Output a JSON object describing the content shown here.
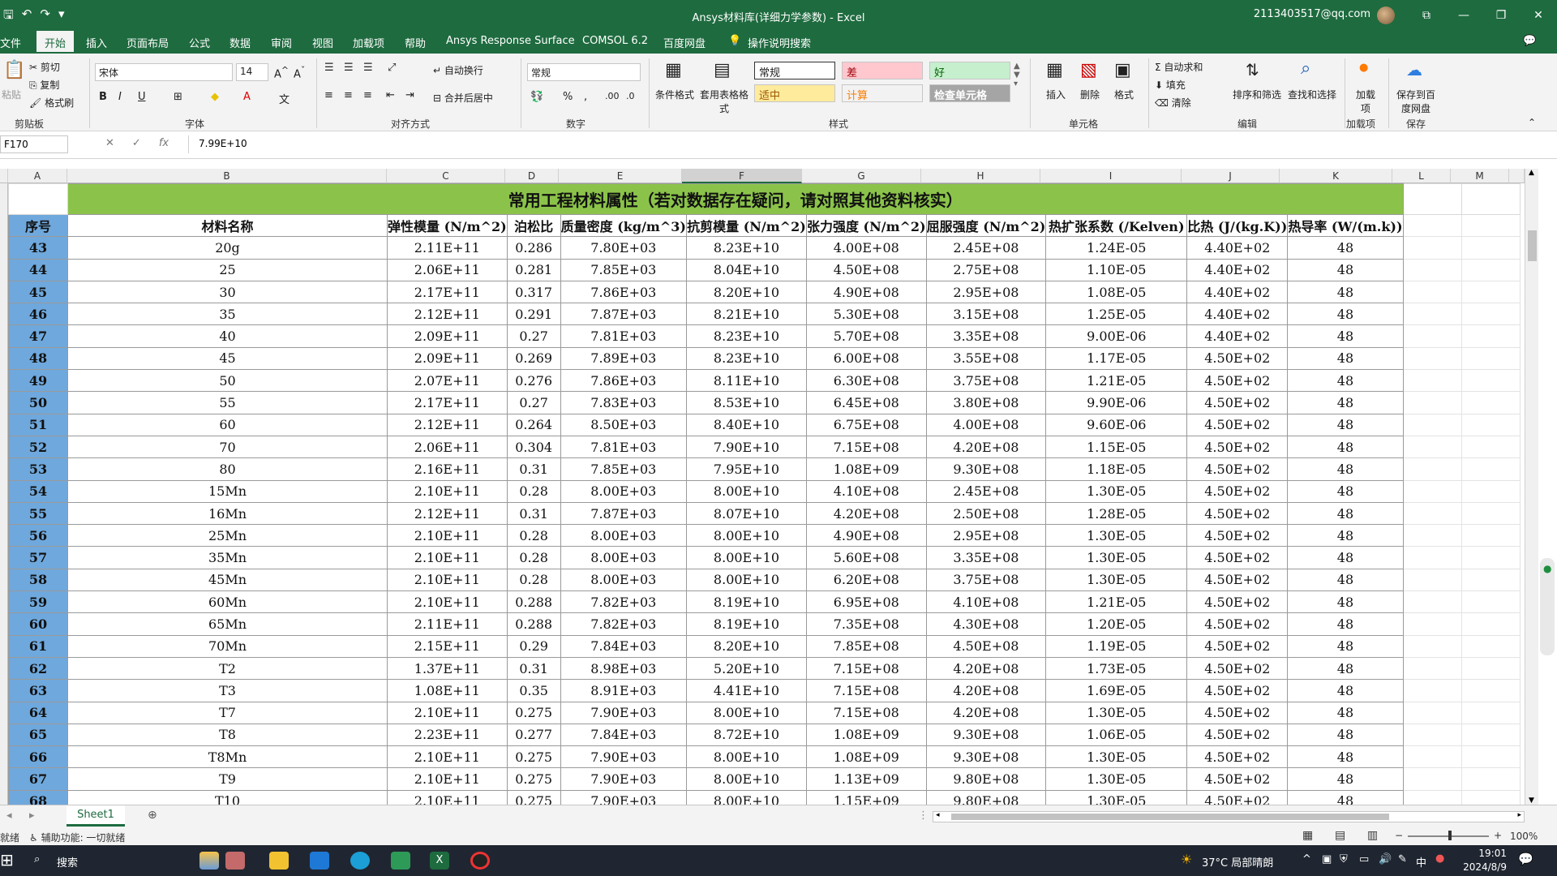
{
  "window": {
    "title": "Ansys材料库(详细力学参数) - Excel",
    "user": "2113403517@qq.com"
  },
  "tabs": [
    "文件",
    "开始",
    "插入",
    "页面布局",
    "公式",
    "数据",
    "审阅",
    "视图",
    "加载项",
    "帮助",
    "Ansys Response Surface",
    "COMSOL 6.2",
    "百度网盘",
    "操作说明搜索"
  ],
  "ribbon": {
    "clipboard": {
      "label": "剪贴板",
      "cut": "剪切",
      "copy": "复制",
      "format_painter": "格式刷",
      "paste": "粘贴"
    },
    "font": {
      "label": "字体",
      "name": "宋体",
      "size": "14"
    },
    "alignment": {
      "label": "对齐方式",
      "wrap": "自动换行",
      "merge": "合并后居中"
    },
    "number": {
      "label": "数字",
      "format": "常规"
    },
    "styles": {
      "label": "样式",
      "conditional": "条件格式",
      "table": "套用表格格式",
      "normal": "常规",
      "bad": "差",
      "good": "好",
      "neutral": "适中",
      "calc": "计算",
      "check": "检查单元格"
    },
    "cells": {
      "label": "单元格",
      "insert": "插入",
      "delete": "删除",
      "format": "格式"
    },
    "editing": {
      "label": "编辑",
      "autosum": "自动求和",
      "fill": "填充",
      "clear": "清除",
      "sort": "排序和筛选",
      "find": "查找和选择"
    },
    "addins": {
      "label": "加载项",
      "btn": "加载项"
    },
    "save": {
      "label": "保存",
      "btn": "保存到百度网盘"
    }
  },
  "formula_bar": {
    "namebox": "F170",
    "value": "7.99E+10"
  },
  "columns": [
    "A",
    "B",
    "C",
    "D",
    "E",
    "F",
    "G",
    "H",
    "I",
    "J",
    "K",
    "L",
    "M"
  ],
  "sheet": {
    "banner": "常用工程材料属性（若对数据存在疑问，请对照其他资料核实）",
    "headers": [
      "序号",
      "材料名称",
      "弹性模量 (N/m^2)",
      "泊松比",
      "质量密度 (kg/m^3)",
      "抗剪模量 (N/m^2)",
      "张力强度 (N/m^2)",
      "屈服强度 (N/m^2)",
      "热扩张系数 (/Kelven)",
      "比热 (J/(kg.K))",
      "热导率 (W/(m.k))"
    ],
    "rows": [
      [
        "43",
        "20g",
        "2.11E+11",
        "0.286",
        "7.80E+03",
        "8.23E+10",
        "4.00E+08",
        "2.45E+08",
        "1.24E-05",
        "4.40E+02",
        "48"
      ],
      [
        "44",
        "25",
        "2.06E+11",
        "0.281",
        "7.85E+03",
        "8.04E+10",
        "4.50E+08",
        "2.75E+08",
        "1.10E-05",
        "4.40E+02",
        "48"
      ],
      [
        "45",
        "30",
        "2.17E+11",
        "0.317",
        "7.86E+03",
        "8.20E+10",
        "4.90E+08",
        "2.95E+08",
        "1.08E-05",
        "4.40E+02",
        "48"
      ],
      [
        "46",
        "35",
        "2.12E+11",
        "0.291",
        "7.87E+03",
        "8.21E+10",
        "5.30E+08",
        "3.15E+08",
        "1.25E-05",
        "4.40E+02",
        "48"
      ],
      [
        "47",
        "40",
        "2.09E+11",
        "0.27",
        "7.81E+03",
        "8.23E+10",
        "5.70E+08",
        "3.35E+08",
        "9.00E-06",
        "4.40E+02",
        "48"
      ],
      [
        "48",
        "45",
        "2.09E+11",
        "0.269",
        "7.89E+03",
        "8.23E+10",
        "6.00E+08",
        "3.55E+08",
        "1.17E-05",
        "4.50E+02",
        "48"
      ],
      [
        "49",
        "50",
        "2.07E+11",
        "0.276",
        "7.86E+03",
        "8.11E+10",
        "6.30E+08",
        "3.75E+08",
        "1.21E-05",
        "4.50E+02",
        "48"
      ],
      [
        "50",
        "55",
        "2.17E+11",
        "0.27",
        "7.83E+03",
        "8.53E+10",
        "6.45E+08",
        "3.80E+08",
        "9.90E-06",
        "4.50E+02",
        "48"
      ],
      [
        "51",
        "60",
        "2.12E+11",
        "0.264",
        "8.50E+03",
        "8.40E+10",
        "6.75E+08",
        "4.00E+08",
        "9.60E-06",
        "4.50E+02",
        "48"
      ],
      [
        "52",
        "70",
        "2.06E+11",
        "0.304",
        "7.81E+03",
        "7.90E+10",
        "7.15E+08",
        "4.20E+08",
        "1.15E-05",
        "4.50E+02",
        "48"
      ],
      [
        "53",
        "80",
        "2.16E+11",
        "0.31",
        "7.85E+03",
        "7.95E+10",
        "1.08E+09",
        "9.30E+08",
        "1.18E-05",
        "4.50E+02",
        "48"
      ],
      [
        "54",
        "15Mn",
        "2.10E+11",
        "0.28",
        "8.00E+03",
        "8.00E+10",
        "4.10E+08",
        "2.45E+08",
        "1.30E-05",
        "4.50E+02",
        "48"
      ],
      [
        "55",
        "16Mn",
        "2.12E+11",
        "0.31",
        "7.87E+03",
        "8.07E+10",
        "4.20E+08",
        "2.50E+08",
        "1.28E-05",
        "4.50E+02",
        "48"
      ],
      [
        "56",
        "25Mn",
        "2.10E+11",
        "0.28",
        "8.00E+03",
        "8.00E+10",
        "4.90E+08",
        "2.95E+08",
        "1.30E-05",
        "4.50E+02",
        "48"
      ],
      [
        "57",
        "35Mn",
        "2.10E+11",
        "0.28",
        "8.00E+03",
        "8.00E+10",
        "5.60E+08",
        "3.35E+08",
        "1.30E-05",
        "4.50E+02",
        "48"
      ],
      [
        "58",
        "45Mn",
        "2.10E+11",
        "0.28",
        "8.00E+03",
        "8.00E+10",
        "6.20E+08",
        "3.75E+08",
        "1.30E-05",
        "4.50E+02",
        "48"
      ],
      [
        "59",
        "60Mn",
        "2.10E+11",
        "0.288",
        "7.82E+03",
        "8.19E+10",
        "6.95E+08",
        "4.10E+08",
        "1.21E-05",
        "4.50E+02",
        "48"
      ],
      [
        "60",
        "65Mn",
        "2.11E+11",
        "0.288",
        "7.82E+03",
        "8.19E+10",
        "7.35E+08",
        "4.30E+08",
        "1.20E-05",
        "4.50E+02",
        "48"
      ],
      [
        "61",
        "70Mn",
        "2.15E+11",
        "0.29",
        "7.84E+03",
        "8.20E+10",
        "7.85E+08",
        "4.50E+08",
        "1.19E-05",
        "4.50E+02",
        "48"
      ],
      [
        "62",
        "T2",
        "1.37E+11",
        "0.31",
        "8.98E+03",
        "5.20E+10",
        "7.15E+08",
        "4.20E+08",
        "1.73E-05",
        "4.50E+02",
        "48"
      ],
      [
        "63",
        "T3",
        "1.08E+11",
        "0.35",
        "8.91E+03",
        "4.41E+10",
        "7.15E+08",
        "4.20E+08",
        "1.69E-05",
        "4.50E+02",
        "48"
      ],
      [
        "64",
        "T7",
        "2.10E+11",
        "0.275",
        "7.90E+03",
        "8.00E+10",
        "7.15E+08",
        "4.20E+08",
        "1.30E-05",
        "4.50E+02",
        "48"
      ],
      [
        "65",
        "T8",
        "2.23E+11",
        "0.277",
        "7.84E+03",
        "8.72E+10",
        "1.08E+09",
        "9.30E+08",
        "1.06E-05",
        "4.50E+02",
        "48"
      ],
      [
        "66",
        "T8Mn",
        "2.10E+11",
        "0.275",
        "7.90E+03",
        "8.00E+10",
        "1.08E+09",
        "9.30E+08",
        "1.30E-05",
        "4.50E+02",
        "48"
      ],
      [
        "67",
        "T9",
        "2.10E+11",
        "0.275",
        "7.90E+03",
        "8.00E+10",
        "1.13E+09",
        "9.80E+08",
        "1.30E-05",
        "4.50E+02",
        "48"
      ],
      [
        "68",
        "T10",
        "2.10E+11",
        "0.275",
        "7.90E+03",
        "8.00E+10",
        "1.15E+09",
        "9.80E+08",
        "1.30E-05",
        "4.50E+02",
        "48"
      ]
    ]
  },
  "sheet_tabs": {
    "active": "Sheet1"
  },
  "status": {
    "ready": "就绪",
    "accessibility": "辅助功能: 一切就绪",
    "zoom": "100%"
  },
  "taskbar": {
    "search": "搜索",
    "weather": "37°C 局部晴朗",
    "time": "19:01",
    "date": "2024/8/9",
    "ime": "中"
  },
  "colors": {
    "excel_green": "#1e6b3f",
    "banner_green": "#8bc34a",
    "seq_blue": "#6fa8dc"
  }
}
